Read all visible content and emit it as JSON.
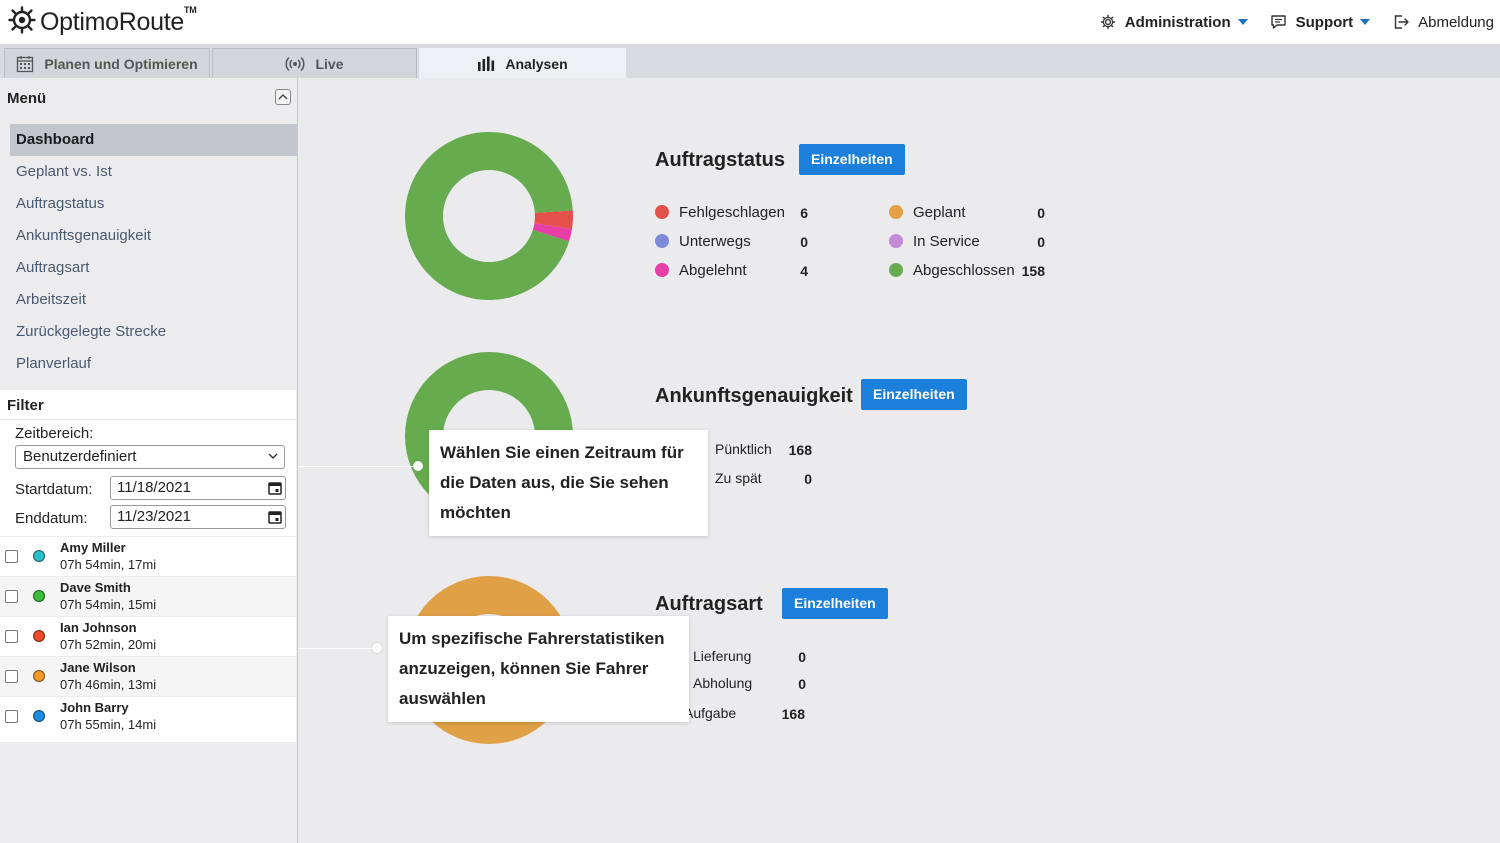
{
  "app": {
    "logo_text": "OptimoRoute",
    "logo_tm": "TM"
  },
  "topnav": {
    "administration": "Administration",
    "support": "Support",
    "logout": "Abmeldung"
  },
  "tabs": [
    {
      "label": "Planen und Optimieren",
      "icon": "calendar-icon"
    },
    {
      "label": "Live",
      "icon": "broadcast-icon"
    },
    {
      "label": "Analysen",
      "icon": "bar-chart-icon",
      "active": true
    }
  ],
  "sidebar": {
    "menu_title": "Menü",
    "items": [
      {
        "label": "Dashboard",
        "active": true
      },
      {
        "label": "Geplant vs. Ist"
      },
      {
        "label": "Auftragstatus"
      },
      {
        "label": "Ankunftsgenauigkeit"
      },
      {
        "label": "Auftragsart"
      },
      {
        "label": "Arbeitszeit"
      },
      {
        "label": "Zurückgelegte Strecke"
      },
      {
        "label": "Planverlauf"
      }
    ]
  },
  "filter": {
    "title": "Filter",
    "range_label": "Zeitbereich:",
    "range_value": "Benutzerdefiniert",
    "start_label": "Startdatum:",
    "start_value": "11/18/2021",
    "end_label": "Enddatum:",
    "end_value": "11/23/2021"
  },
  "drivers": [
    {
      "name": "Amy Miller",
      "stats": "07h 54min, 17mi",
      "color": "#2bbfc9"
    },
    {
      "name": "Dave Smith",
      "stats": "07h 54min, 15mi",
      "color": "#3bbf3b"
    },
    {
      "name": "Ian Johnson",
      "stats": "07h 52min, 20mi",
      "color": "#e84a2a"
    },
    {
      "name": "Jane Wilson",
      "stats": "07h 46min, 13mi",
      "color": "#f09a2a"
    },
    {
      "name": "John Barry",
      "stats": "07h 55min, 14mi",
      "color": "#1a8be0"
    }
  ],
  "sections": {
    "status": {
      "title": "Auftragstatus",
      "button": "Einzelheiten",
      "legend": [
        {
          "label": "Fehlgeschlagen",
          "value": "6",
          "color": "#e5514a"
        },
        {
          "label": "Unterwegs",
          "value": "0",
          "color": "#7d8ad8"
        },
        {
          "label": "Abgelehnt",
          "value": "4",
          "color": "#e83fa6"
        },
        {
          "label": "Geplant",
          "value": "0",
          "color": "#e3a044"
        },
        {
          "label": "In Service",
          "value": "0",
          "color": "#c48ad6"
        },
        {
          "label": "Abgeschlossen",
          "value": "158",
          "color": "#67ab4f"
        }
      ]
    },
    "accuracy": {
      "title": "Ankunftsgenauigkeit",
      "button": "Einzelheiten",
      "legend": [
        {
          "label": "Pünktlich",
          "value": "168"
        },
        {
          "label": "Zu spät",
          "value": "0"
        }
      ]
    },
    "type": {
      "title": "Auftragsart",
      "button": "Einzelheiten",
      "legend": [
        {
          "label": "Lieferung",
          "value": "0"
        },
        {
          "label": "Abholung",
          "value": "0"
        },
        {
          "label": "Aufgabe",
          "value": "168",
          "color": "#e0a046"
        }
      ]
    }
  },
  "callouts": {
    "period_line1": "Wählen Sie einen Zeitraum für",
    "period_line2": "die Daten aus, die Sie sehen möchten",
    "driver_line1": "Um spezifische Fahrerstatistiken",
    "driver_line2": "anzuzeigen, können Sie Fahrer auswählen"
  },
  "chart_data": [
    {
      "type": "pie",
      "title": "Auftragstatus",
      "labels": [
        "Fehlgeschlagen",
        "Unterwegs",
        "Abgelehnt",
        "Geplant",
        "In Service",
        "Abgeschlossen"
      ],
      "values": [
        6,
        0,
        4,
        0,
        0,
        158
      ],
      "colors": [
        "#e5514a",
        "#7d8ad8",
        "#e83fa6",
        "#e3a044",
        "#c48ad6",
        "#67ab4f"
      ]
    },
    {
      "type": "pie",
      "title": "Ankunftsgenauigkeit",
      "labels": [
        "Pünktlich",
        "Zu spät"
      ],
      "values": [
        168,
        0
      ],
      "colors": [
        "#67ab4f",
        "#e5514a"
      ]
    },
    {
      "type": "pie",
      "title": "Auftragsart",
      "labels": [
        "Lieferung",
        "Abholung",
        "Aufgabe"
      ],
      "values": [
        0,
        0,
        168
      ],
      "colors": [
        "#7d8ad8",
        "#c48ad6",
        "#e0a046"
      ]
    }
  ]
}
